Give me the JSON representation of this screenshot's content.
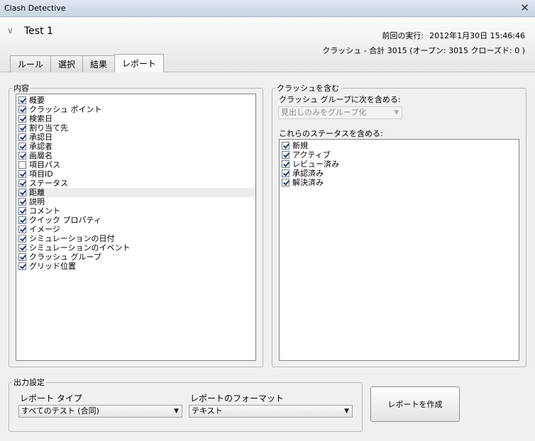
{
  "window": {
    "title": "Clash Detective"
  },
  "header": {
    "test_name": "Test 1",
    "last_run_label": "前回の実行:",
    "last_run_value": "2012年1月30日 15:46:46",
    "summary": "クラッシュ - 合計 3015 (オープン: 3015 クローズド: 0 )"
  },
  "tabs": [
    {
      "label": "ルール",
      "active": false
    },
    {
      "label": "選択",
      "active": false
    },
    {
      "label": "結果",
      "active": false
    },
    {
      "label": "レポート",
      "active": true
    }
  ],
  "contents": {
    "legend": "内容",
    "items": [
      {
        "label": "概要",
        "checked": true
      },
      {
        "label": "クラッシュ ポイント",
        "checked": true
      },
      {
        "label": "検索日",
        "checked": true
      },
      {
        "label": "割り当て先",
        "checked": true
      },
      {
        "label": "承認日",
        "checked": true
      },
      {
        "label": "承認者",
        "checked": true
      },
      {
        "label": "画層名",
        "checked": true
      },
      {
        "label": "項目パス",
        "checked": false
      },
      {
        "label": "項目ID",
        "checked": true
      },
      {
        "label": "ステータス",
        "checked": true
      },
      {
        "label": "距離",
        "checked": true
      },
      {
        "label": "説明",
        "checked": true
      },
      {
        "label": "コメント",
        "checked": true
      },
      {
        "label": "クイック プロパティ",
        "checked": true
      },
      {
        "label": "イメージ",
        "checked": true
      },
      {
        "label": "シミュレーションの日付",
        "checked": true
      },
      {
        "label": "シミュレーションのイベント",
        "checked": true
      },
      {
        "label": "クラッシュ グループ",
        "checked": true
      },
      {
        "label": "グリッド位置",
        "checked": true
      }
    ]
  },
  "include": {
    "legend": "クラッシュを含む",
    "group_label": "クラッシュ グループに次を含める:",
    "group_value": "見出しのみをグループ化",
    "status_label": "これらのステータスを含める:",
    "statuses": [
      {
        "label": "新規",
        "checked": true
      },
      {
        "label": "アクティブ",
        "checked": true
      },
      {
        "label": "レビュー済み",
        "checked": true
      },
      {
        "label": "承認済み",
        "checked": true
      },
      {
        "label": "解決済み",
        "checked": true
      }
    ]
  },
  "output": {
    "legend": "出力設定",
    "report_type_label": "レポート タイプ",
    "report_type_value": "すべてのテスト (合同)",
    "report_format_label": "レポートのフォーマット",
    "report_format_value": "テキスト"
  },
  "create_button_label": "レポートを作成",
  "icons": {
    "collapse": "chevron-down-icon",
    "close": "close-icon",
    "dropdown": "triangle-down-icon"
  }
}
